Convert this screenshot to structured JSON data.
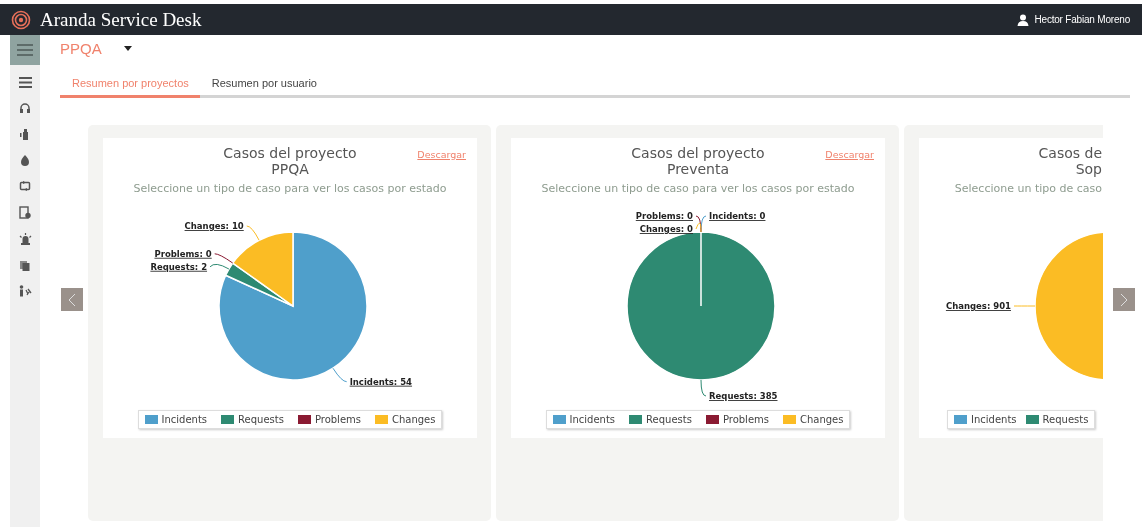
{
  "header": {
    "title": "Aranda Service Desk",
    "user": "Hector Fabian Moreno"
  },
  "project_selector": {
    "value": "PPQA"
  },
  "tabs": [
    {
      "label": "Resumen por proyectos",
      "selected": true
    },
    {
      "label": "Resumen por usuario",
      "selected": false
    }
  ],
  "cards": [
    {
      "title": "Casos del proyecto",
      "project": "PPQA",
      "download_link": "Descargar",
      "subtitle": "Seleccione un tipo de caso para ver los casos por estado",
      "legend": [
        {
          "label": "Incidents",
          "color": "#4f9fcb"
        },
        {
          "label": "Requests",
          "color": "#2e8a72"
        },
        {
          "label": "Problems",
          "color": "#8a1a32"
        },
        {
          "label": "Changes",
          "color": "#fbbc24"
        }
      ],
      "chart_data": {
        "type": "pie",
        "values": [
          54,
          2,
          0,
          10
        ],
        "colors": [
          "#4f9fcb",
          "#2e8a72",
          "#8a1a32",
          "#fbbc24"
        ],
        "value_labels": [
          "Incidents: 54",
          "Requests: 2",
          "Problems: 0",
          "Changes: 10"
        ]
      }
    },
    {
      "title": "Casos del proyecto",
      "project": "Preventa",
      "download_link": "Descargar",
      "subtitle": "Seleccione un tipo de caso para ver los casos por estado",
      "legend": [
        {
          "label": "Incidents",
          "color": "#4f9fcb"
        },
        {
          "label": "Requests",
          "color": "#2e8a72"
        },
        {
          "label": "Problems",
          "color": "#8a1a32"
        },
        {
          "label": "Changes",
          "color": "#fbbc24"
        }
      ],
      "chart_data": {
        "type": "pie",
        "values": [
          0,
          385,
          0,
          0
        ],
        "colors": [
          "#4f9fcb",
          "#2e8a72",
          "#8a1a32",
          "#fbbc24"
        ],
        "value_labels": [
          "Incidents: 0",
          "Requests: 385",
          "Problems: 0",
          "Changes: 0"
        ]
      }
    },
    {
      "title": "Casos de",
      "project": "Sop",
      "subtitle": "Seleccione un tipo de caso",
      "legend": [
        {
          "label": "Incidents",
          "color": "#4f9fcb"
        },
        {
          "label": "Requests",
          "color": "#2e8a72"
        }
      ],
      "chart_data": {
        "type": "pie",
        "values": [
          901
        ],
        "colors": [
          "#fbbc24"
        ],
        "value_labels": [
          "Changes: 901"
        ]
      }
    }
  ]
}
